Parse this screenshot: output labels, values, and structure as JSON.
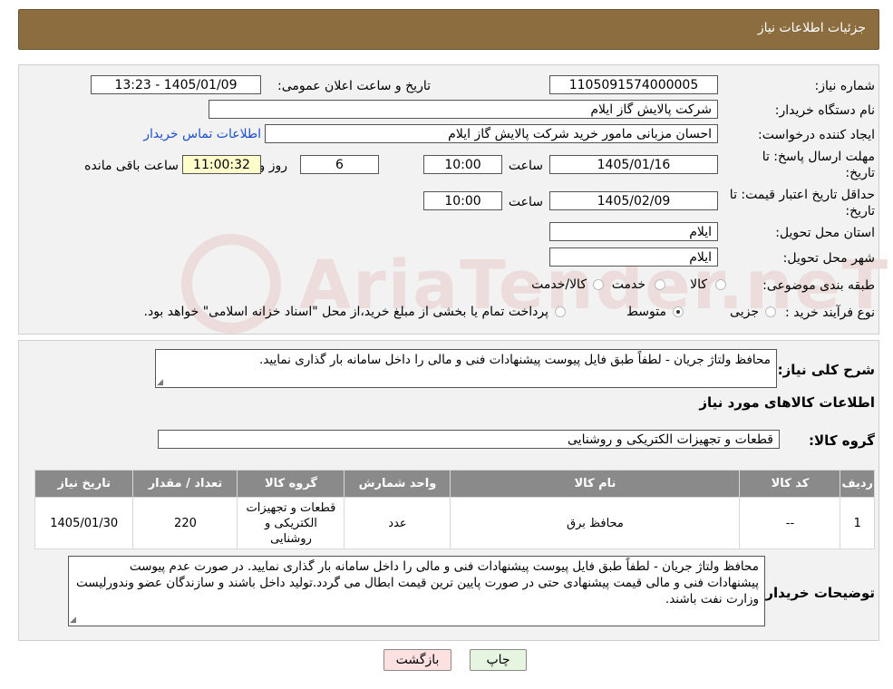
{
  "header": {
    "title": "جزئیات اطلاعات نیاز"
  },
  "form": {
    "need_number_label": "شماره نیاز:",
    "need_number": "1105091574000005",
    "announce_label": "تاریخ و ساعت اعلان عمومی:",
    "announce_value": "1405/01/09 - 13:23",
    "buyer_org_label": "نام دستگاه خریدار:",
    "buyer_org": "شرکت پالایش گاز ایلام",
    "creator_label": "ایجاد کننده درخواست:",
    "creator": "احسان مزبانی مامور خرید شرکت پالایش گاز ایلام",
    "contact_link": "اطلاعات تماس خریدار",
    "deadline_label_1": "مهلت ارسال پاسخ: تا",
    "deadline_label_2": "تاریخ:",
    "deadline_date": "1405/01/16",
    "time_label": "ساعت",
    "deadline_time": "10:00",
    "days_value": "6",
    "days_label": "روز و",
    "remaining_time": "11:00:32",
    "remaining_label": "ساعت باقی مانده",
    "validity_label_1": "حداقل تاریخ اعتبار قیمت: تا",
    "validity_label_2": "تاریخ:",
    "validity_date": "1405/02/09",
    "validity_time": "10:00",
    "province_label": "استان محل تحویل:",
    "province": "ایلام",
    "city_label": "شهر محل تحویل:",
    "city": "ایلام",
    "category_label": "طبقه بندی موضوعی:",
    "category_options": [
      "کالا",
      "خدمت",
      "کالا/خدمت"
    ],
    "process_label": "نوع فرآیند خرید :",
    "process_options": [
      "جزیی",
      "متوسط"
    ],
    "process_note": "پرداخت تمام یا بخشی از مبلغ خرید،از محل \"اسناد خزانه اسلامی\" خواهد بود."
  },
  "summary": {
    "description_label": "شرح کلی نیاز:",
    "description": "محافظ ولتاژ جریان - لطفاً طبق فایل پیوست پیشنهادات فنی و مالی را داخل سامانه بار گذاری نمایید.",
    "goods_info_title": "اطلاعات کالاهای مورد نیاز",
    "goods_group_label": "گروه کالا:",
    "goods_group": "قطعات و تجهیزات الکتریکی و روشنایی"
  },
  "table": {
    "headers": [
      "ردیف",
      "کد کالا",
      "نام کالا",
      "واحد شمارش",
      "گروه کالا",
      "تعداد / مقدار",
      "تاریخ نیاز"
    ],
    "row": [
      "1",
      "--",
      "محافظ برق",
      "عدد",
      "قطعات و تجهیزات الکتریکی و روشنایی",
      "220",
      "1405/01/30"
    ]
  },
  "buyer_notes_label": "توضیحات خریدار:",
  "buyer_notes": "محافظ ولتاژ جریان - لطفاً طبق فایل پیوست پیشنهادات فنی و مالی را داخل سامانه بار گذاری نمایید. در صورت عدم پیوست پیشنهادات فنی و مالی قیمت پیشنهادی حتی در صورت پایین ترین قیمت ابطال می گردد.تولید داخل باشند و سازندگان عضو وندورلیست وزارت نفت باشند.",
  "buttons": {
    "print": "چاپ",
    "back": "بازگشت"
  },
  "colors": {
    "header_bg": "#8b6d40",
    "table_header_bg": "#8a8a8a",
    "back_button_bg": "#fde0e0",
    "print_button_bg": "#e6f5e0"
  }
}
